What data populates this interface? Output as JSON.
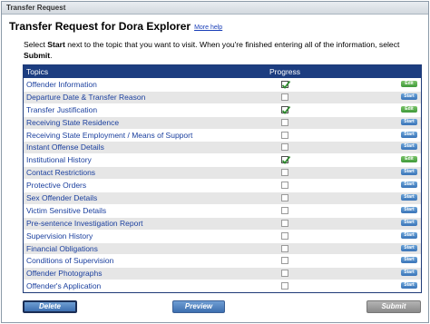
{
  "window": {
    "title": "Transfer Request"
  },
  "page": {
    "heading": "Transfer Request for Dora Explorer",
    "more_help": "More help",
    "instructions": {
      "p1": "Select ",
      "b1": "Start",
      "p2": " next to the topic that you want to visit. When you're finished entering all of the information, select ",
      "b2": "Submit",
      "p3": "."
    }
  },
  "grid": {
    "col_topics": "Topics",
    "col_progress": "Progress",
    "rows": [
      {
        "topic": "Offender Information",
        "done": true,
        "action": "Edit"
      },
      {
        "topic": "Departure Date & Transfer Reason",
        "done": false,
        "action": "Start"
      },
      {
        "topic": "Transfer Justification",
        "done": true,
        "action": "Edit"
      },
      {
        "topic": "Receiving State Residence",
        "done": false,
        "action": "Start"
      },
      {
        "topic": "Receiving State Employment / Means of Support",
        "done": false,
        "action": "Start"
      },
      {
        "topic": "Instant Offense Details",
        "done": false,
        "action": "Start"
      },
      {
        "topic": "Institutional History",
        "done": true,
        "action": "Edit"
      },
      {
        "topic": "Contact Restrictions",
        "done": false,
        "action": "Start"
      },
      {
        "topic": "Protective Orders",
        "done": false,
        "action": "Start"
      },
      {
        "topic": "Sex Offender Details",
        "done": false,
        "action": "Start"
      },
      {
        "topic": "Victim Sensitive Details",
        "done": false,
        "action": "Start"
      },
      {
        "topic": "Pre-sentence Investigation Report",
        "done": false,
        "action": "Start"
      },
      {
        "topic": "Supervision History",
        "done": false,
        "action": "Start"
      },
      {
        "topic": "Financial Obligations",
        "done": false,
        "action": "Start"
      },
      {
        "topic": "Conditions of Supervision",
        "done": false,
        "action": "Start"
      },
      {
        "topic": "Offender Photographs",
        "done": false,
        "action": "Start"
      },
      {
        "topic": "Offender's Application",
        "done": false,
        "action": "Start"
      }
    ]
  },
  "buttons": {
    "delete": "Delete",
    "preview": "Preview",
    "submit": "Submit"
  },
  "colors": {
    "header_bg": "#1c3d80",
    "topic_link": "#1a3f9e",
    "start_button": "#3a74b8",
    "edit_button": "#3f9a3a",
    "submit_disabled": "#8a8a8a"
  }
}
